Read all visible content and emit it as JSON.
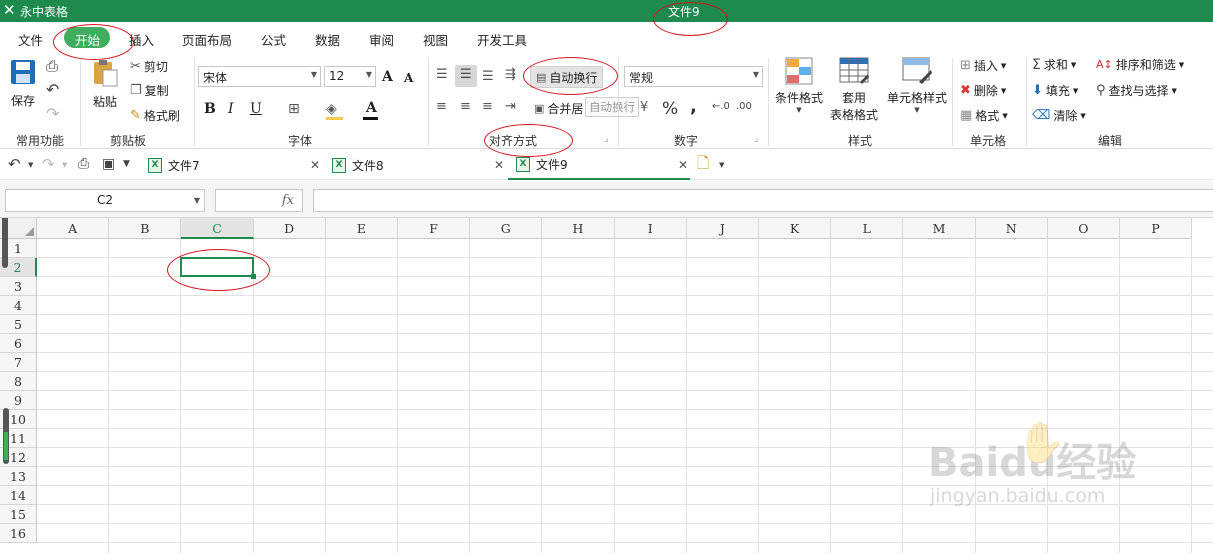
{
  "app": {
    "name": "永中表格",
    "doc_title": "文件9"
  },
  "menu": [
    "文件",
    "开始",
    "插入",
    "页面布局",
    "公式",
    "数据",
    "审阅",
    "视图",
    "开发工具"
  ],
  "ribbon": {
    "common": {
      "save": "保存",
      "label": "常用功能"
    },
    "clipboard": {
      "paste": "粘贴",
      "cut": "剪切",
      "copy": "复制",
      "format_painter": "格式刷",
      "label": "剪贴板"
    },
    "font": {
      "name": "宋体",
      "size": "12",
      "bold": "B",
      "italic": "I",
      "underline": "U",
      "font_color": "A",
      "grow": "A",
      "shrink": "A",
      "label": "字体"
    },
    "align": {
      "wrap": "自动换行",
      "merge": "合并居",
      "tooltip": "自动换行",
      "label": "对齐方式"
    },
    "number": {
      "format": "常规",
      "percent": "%",
      "comma": ",",
      "label": "数字"
    },
    "styles": {
      "conditional": "条件格式",
      "table_l1": "套用",
      "table_l2": "表格格式",
      "cell_style": "单元格样式",
      "label": "样式"
    },
    "cells": {
      "insert": "插入",
      "delete": "删除",
      "format": "格式",
      "label": "单元格"
    },
    "editing": {
      "sum": "求和",
      "fill": "填充",
      "clear": "清除",
      "sort": "排序和筛选",
      "find": "查找与选择",
      "label": "编辑"
    }
  },
  "tabs": [
    "文件7",
    "文件8",
    "文件9"
  ],
  "formula_bar": {
    "cell_ref": "C2",
    "fx": "fx",
    "content": ""
  },
  "sheet": {
    "columns": [
      "A",
      "B",
      "C",
      "D",
      "E",
      "F",
      "G",
      "H",
      "I",
      "J",
      "K",
      "L",
      "M",
      "N",
      "O",
      "P"
    ],
    "rows": [
      "1",
      "2",
      "3",
      "4",
      "5",
      "6",
      "7",
      "8",
      "9",
      "10",
      "11",
      "12",
      "13",
      "14",
      "15",
      "16"
    ],
    "selected": "C2"
  },
  "watermark": {
    "brand": "Baidu经验",
    "url": "jingyan.baidu.com"
  },
  "colors": {
    "title_green": "#1e8a4e",
    "active_tab_green": "#3fae5f",
    "annotation_red": "#d2141d",
    "accent_blue": "#1f6fb8"
  }
}
